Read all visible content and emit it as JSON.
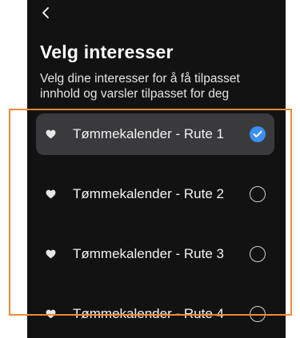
{
  "header": {
    "back_label": "<",
    "title": "Velg interesser",
    "subtitle": "Velg dine interesser for å få tilpasset innhold og varsler tilpasset for deg"
  },
  "interests": [
    {
      "label": "Tømmekalender - Rute 1",
      "selected": true,
      "icon": "heart-icon"
    },
    {
      "label": "Tømmekalender - Rute 2",
      "selected": false,
      "icon": "heart-icon"
    },
    {
      "label": "Tømmekalender - Rute 3",
      "selected": false,
      "icon": "heart-icon"
    },
    {
      "label": "Tømmekalender - Rute 4",
      "selected": false,
      "icon": "heart-icon"
    }
  ],
  "colors": {
    "background": "#121212",
    "selected_row": "#3a3a3c",
    "check_accent": "#3b8ff2",
    "highlight_outline": "#f28a32"
  }
}
